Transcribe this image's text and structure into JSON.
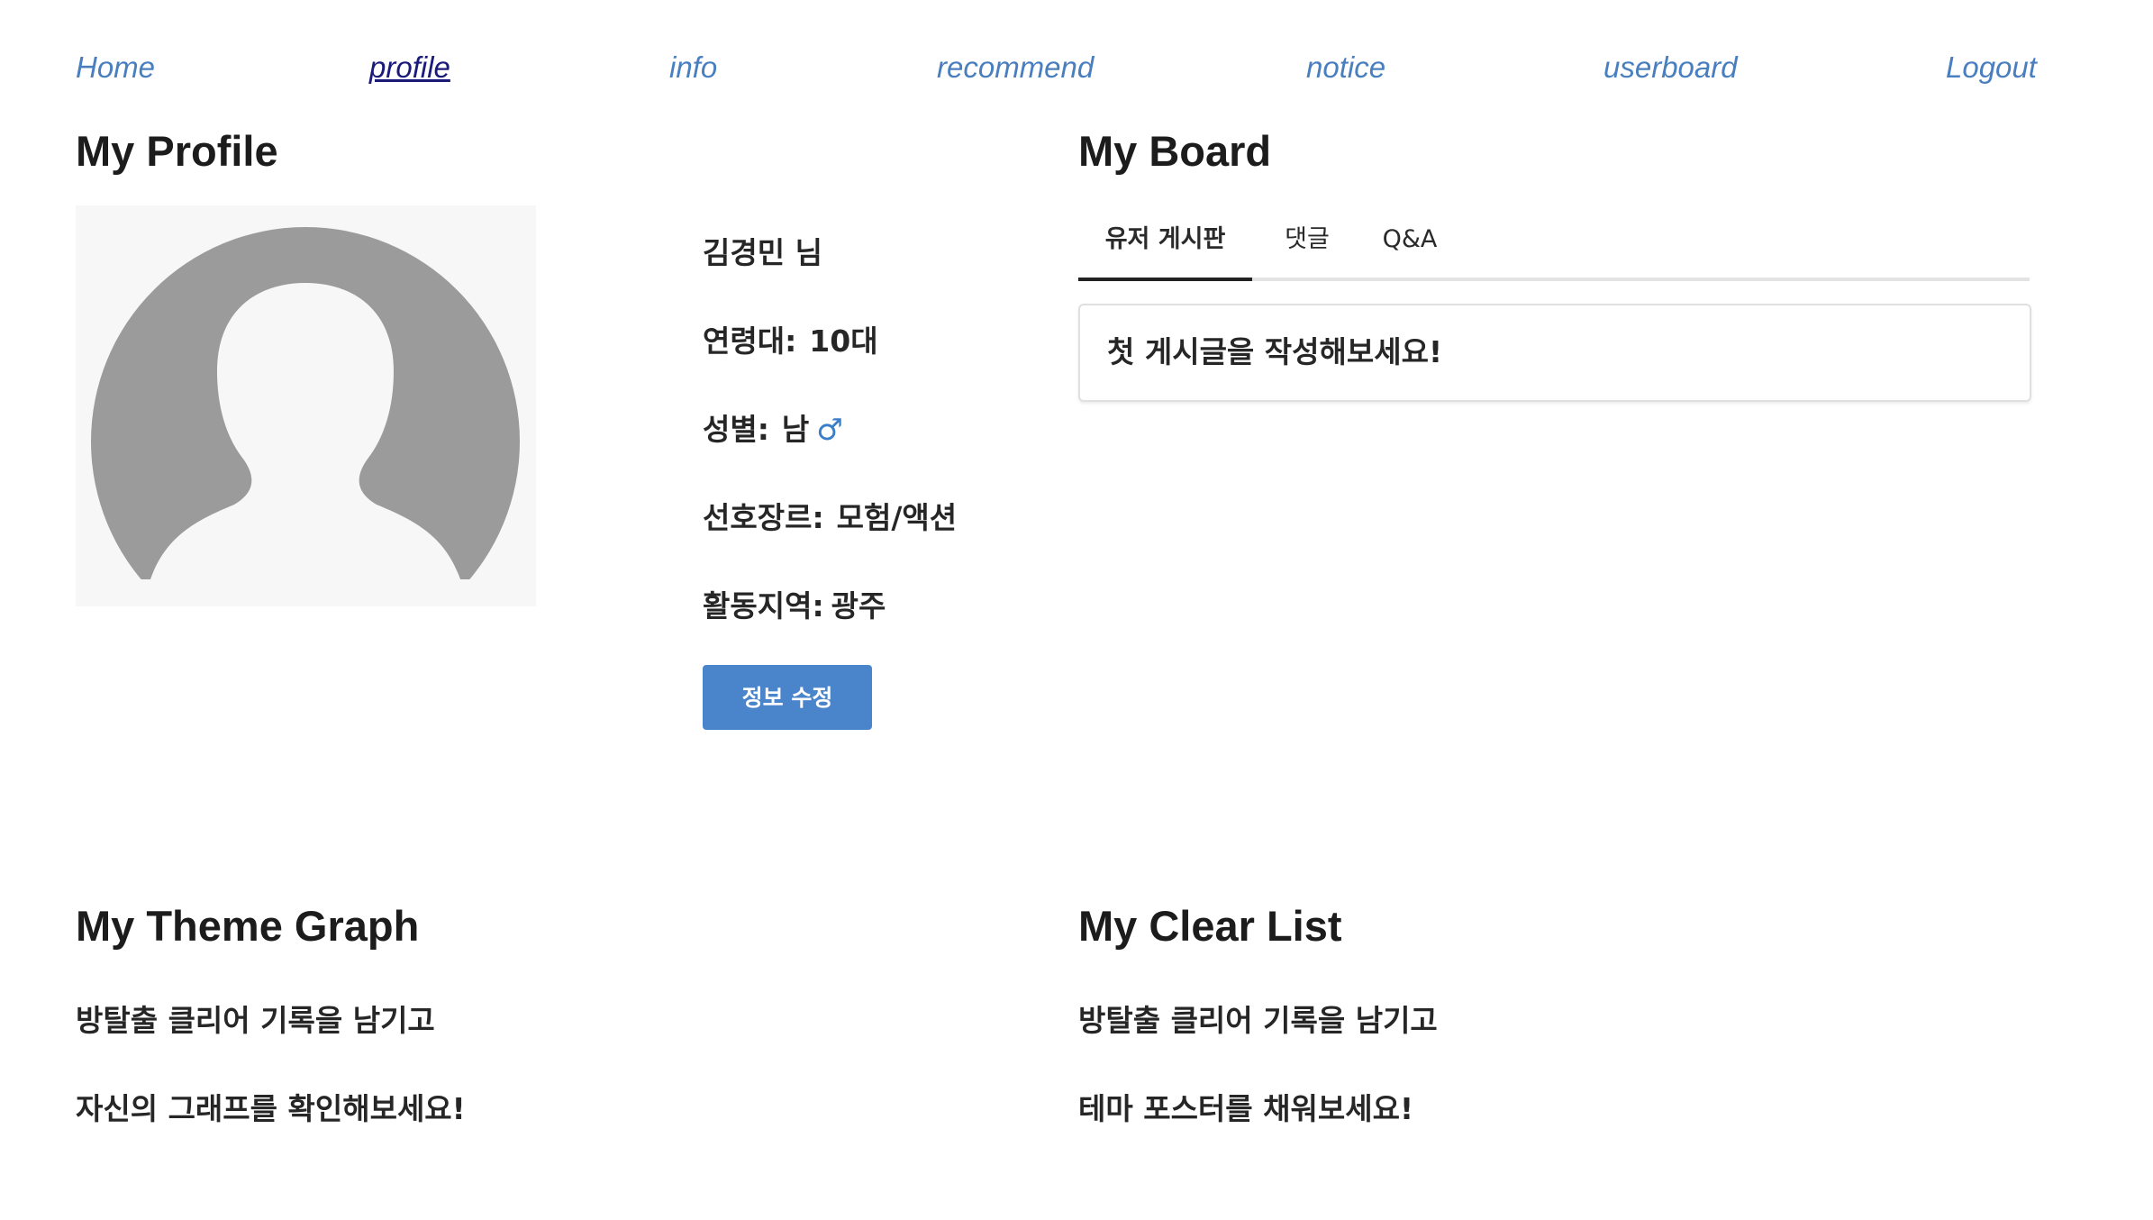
{
  "nav": {
    "items": [
      {
        "label": "Home"
      },
      {
        "label": "profile",
        "active": true
      },
      {
        "label": "info"
      },
      {
        "label": "recommend"
      },
      {
        "label": "notice"
      },
      {
        "label": "userboard"
      },
      {
        "label": "Logout"
      }
    ]
  },
  "profile": {
    "title": "My Profile",
    "avatar_icon": "default-user-avatar-icon",
    "name": "김경민 님",
    "age_label": "연령대:",
    "age_value": "10대",
    "gender_label": "성별:",
    "gender_value": "남",
    "gender_symbol": "♂",
    "genre_label": "선호장르:",
    "genre_value": "모험/액션",
    "region_label": "활동지역:",
    "region_value": "광주",
    "edit_button": "정보 수정"
  },
  "board": {
    "title": "My Board",
    "tabs": [
      {
        "label": "유저 게시판",
        "active": true
      },
      {
        "label": "댓글"
      },
      {
        "label": "Q&A"
      }
    ],
    "empty_message": "첫 게시글을 작성해보세요!"
  },
  "theme_graph": {
    "title": "My Theme Graph",
    "line1": "방탈출 클리어 기록을 남기고",
    "line2": "자신의 그래프를 확인해보세요!"
  },
  "clear_list": {
    "title": "My Clear List",
    "line1": "방탈출 클리어 기록을 남기고",
    "line2": "테마 포스터를 채워보세요!"
  },
  "colors": {
    "nav_link": "#4a7fbf",
    "nav_active": "#1a1a7a",
    "button": "#4a85cc",
    "avatar_fill": "#9b9b9b",
    "avatar_bg": "#f7f7f7",
    "gender_symbol": "#3b7ec8"
  }
}
